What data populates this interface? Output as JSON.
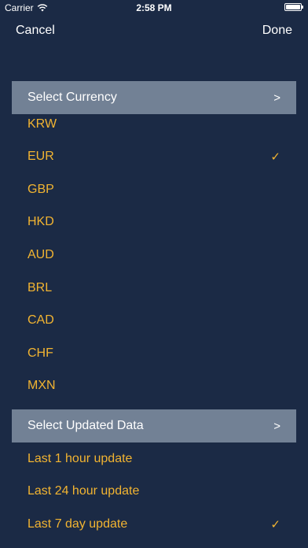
{
  "status_bar": {
    "carrier": "Carrier",
    "time": "2:58 PM"
  },
  "nav": {
    "cancel_label": "Cancel",
    "done_label": "Done"
  },
  "currency_section": {
    "title": "Select Currency",
    "chevron": ">",
    "items": [
      {
        "label": "KRW",
        "selected": false
      },
      {
        "label": "EUR",
        "selected": true
      },
      {
        "label": "GBP",
        "selected": false
      },
      {
        "label": "HKD",
        "selected": false
      },
      {
        "label": "AUD",
        "selected": false
      },
      {
        "label": "BRL",
        "selected": false
      },
      {
        "label": "CAD",
        "selected": false
      },
      {
        "label": "CHF",
        "selected": false
      },
      {
        "label": "MXN",
        "selected": false
      }
    ]
  },
  "update_section": {
    "title": "Select Updated Data",
    "chevron": ">",
    "items": [
      {
        "label": "Last 1  hour update",
        "selected": false
      },
      {
        "label": "Last 24 hour update",
        "selected": false
      },
      {
        "label": "Last 7  day  update",
        "selected": true
      }
    ]
  },
  "check_glyph": "✓",
  "colors": {
    "background": "#1b2a45",
    "header": "#728195",
    "accent": "#f2b431",
    "text": "#ffffff"
  },
  "icons": {
    "wifi": "wifi-icon",
    "battery": "battery-icon",
    "chevron": "chevron-right-icon",
    "check": "checkmark-icon"
  }
}
